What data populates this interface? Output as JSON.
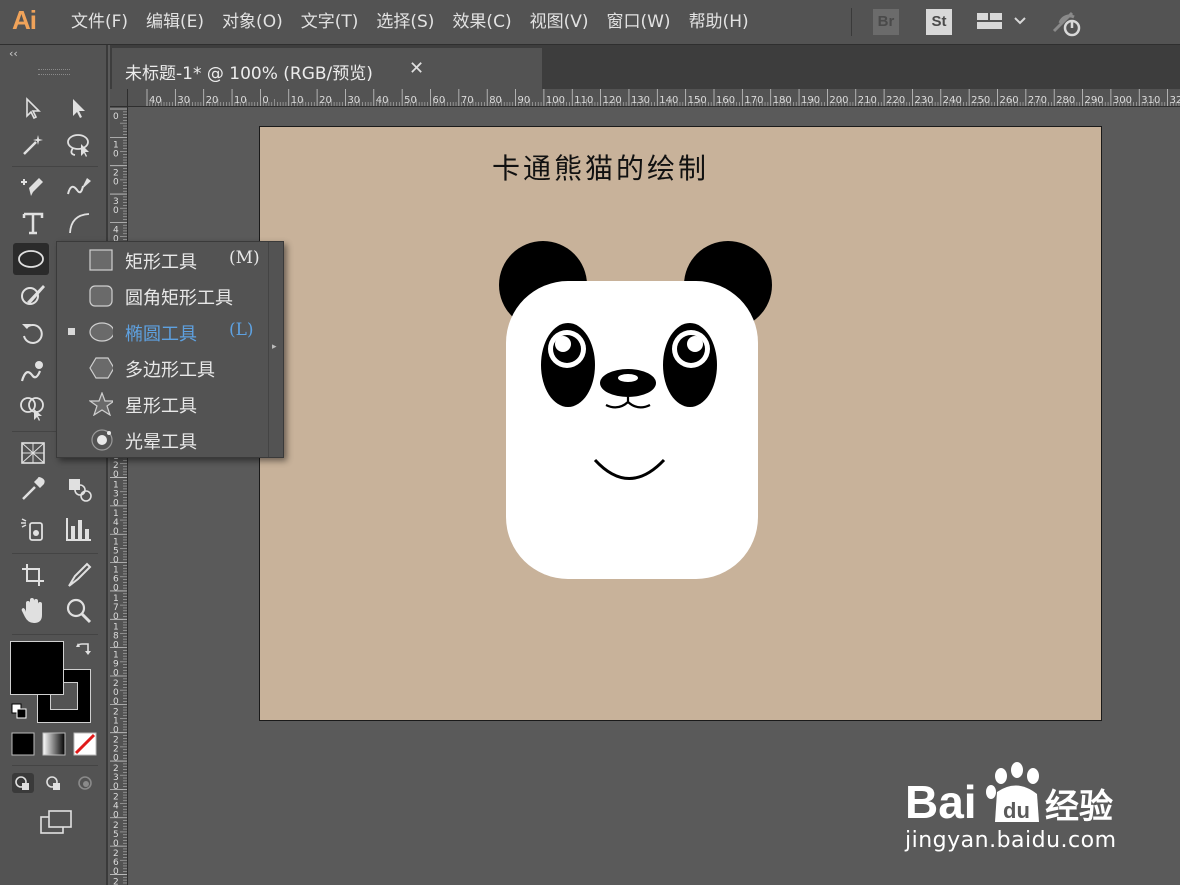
{
  "app": {
    "logo": "Ai"
  },
  "menu": [
    "文件(F)",
    "编辑(E)",
    "对象(O)",
    "文字(T)",
    "选择(S)",
    "效果(C)",
    "视图(V)",
    "窗口(W)",
    "帮助(H)"
  ],
  "header_icons": {
    "bridge": "Br",
    "stock": "St"
  },
  "document_tab": {
    "title": "未标题-1* @ 100% (RGB/预览)",
    "close": "✕"
  },
  "ruler": {
    "top_labels": [
      "40",
      "30",
      "20",
      "10",
      "0",
      "10",
      "20",
      "30",
      "40",
      "50",
      "60",
      "70",
      "80",
      "90",
      "100",
      "110",
      "120",
      "130",
      "140",
      "150",
      "160",
      "170",
      "180",
      "190",
      "200",
      "210",
      "220",
      "230",
      "240",
      "250",
      "260",
      "270",
      "280",
      "290",
      "300",
      "310",
      "32"
    ],
    "left_labels": [
      "0",
      "1 0",
      "2 0",
      "3 0",
      "4 0",
      "5 0",
      "6 0",
      "7 0",
      "8 0",
      "9 0",
      "1 0 0",
      "1 1 0",
      "1 2 0",
      "1 3 0",
      "1 4 0",
      "1 5 0",
      "1 6 0",
      "1 7 0",
      "1 8 0",
      "1 9 0",
      "2 0 0",
      "2 1 0",
      "2 2 0",
      "2 3 0",
      "2 4 0",
      "2 5 0",
      "2 6 0",
      "2 7 0"
    ]
  },
  "artboard": {
    "title": "卡通熊猫的绘制",
    "background_color": "#c8b29a"
  },
  "flyout": {
    "items": [
      {
        "label": "矩形工具",
        "shortcut": "(M)",
        "icon": "rectangle-icon"
      },
      {
        "label": "圆角矩形工具",
        "shortcut": "",
        "icon": "rounded-rectangle-icon"
      },
      {
        "label": "椭圆工具",
        "shortcut": "(L)",
        "icon": "ellipse-icon",
        "selected": true
      },
      {
        "label": "多边形工具",
        "shortcut": "",
        "icon": "polygon-icon"
      },
      {
        "label": "星形工具",
        "shortcut": "",
        "icon": "star-icon"
      },
      {
        "label": "光晕工具",
        "shortcut": "",
        "icon": "flare-icon"
      }
    ],
    "selected_color": "#5ea1e0"
  },
  "colors": {
    "fill": "#000000",
    "stroke": "#000000",
    "ui_gray": "#535353"
  },
  "watermark": {
    "text": "jingyan.baidu.com",
    "brand": "Bai 经验"
  }
}
